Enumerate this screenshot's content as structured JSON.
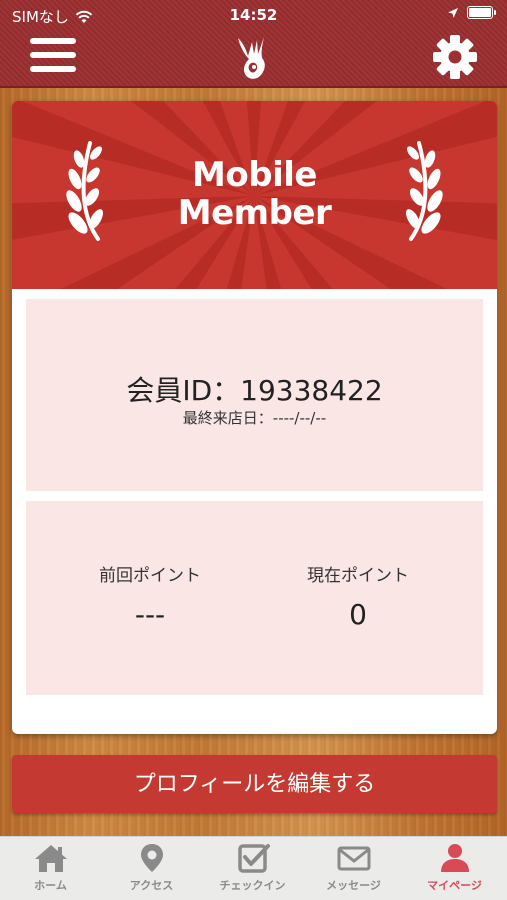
{
  "status_bar": {
    "carrier": "SIMなし",
    "time": "14:52"
  },
  "header": {
    "menu_icon": "hamburger-menu-icon",
    "logo_icon": "rooster-logo",
    "settings_icon": "gear-icon"
  },
  "banner": {
    "title_line1": "Mobile",
    "title_line2": "Member",
    "color": "#c8372f"
  },
  "member": {
    "id_text": "会員ID：19338422",
    "last_visit_text": "最終来店日：----/--/--"
  },
  "points": {
    "previous_label": "前回ポイント",
    "previous_value": "---",
    "current_label": "現在ポイント",
    "current_value": "0"
  },
  "edit_profile_button": "プロフィールを編集する",
  "tabs": [
    {
      "label": "ホーム",
      "icon": "home-icon",
      "active": false
    },
    {
      "label": "アクセス",
      "icon": "map-pin-icon",
      "active": false
    },
    {
      "label": "チェックイン",
      "icon": "checkbox-icon",
      "active": false
    },
    {
      "label": "メッセージ",
      "icon": "envelope-icon",
      "active": false
    },
    {
      "label": "マイページ",
      "icon": "person-icon",
      "active": true
    }
  ],
  "colors": {
    "header": "#9b2f31",
    "accent": "#c43a33",
    "active_tab": "#d94a57",
    "panel": "#fbe6e6"
  }
}
